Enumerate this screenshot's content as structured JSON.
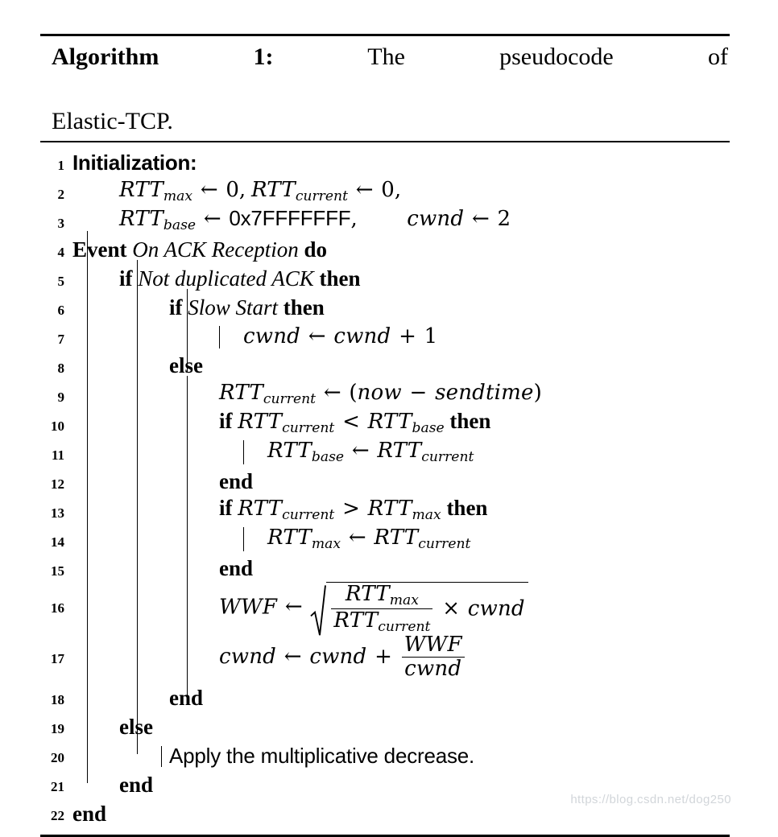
{
  "caption": {
    "label": "Algorithm 1:",
    "text_rest": "The pseudocode of",
    "line2": "Elastic-TCP."
  },
  "keywords": {
    "event": "Event",
    "do": "do",
    "if": "if",
    "then": "then",
    "else": "else",
    "end": "end"
  },
  "symbols": {
    "assign": "←",
    "lt": "<",
    "gt": ">",
    "plus": "+",
    "minus": "−",
    "times": "×",
    "comma": ",",
    "lparen": "(",
    "rparen": ")"
  },
  "vars": {
    "RTT": "RTT",
    "sub_max": "max",
    "sub_current": "current",
    "sub_base": "base",
    "cwnd": "cwnd",
    "WWF": "WWF",
    "now": "now",
    "sendtime": "sendtime"
  },
  "values": {
    "zero": "0",
    "one": "1",
    "two": "2",
    "hex_max": "0x7FFFFFFF"
  },
  "lines": [
    {
      "no": "1",
      "text": "Initialization:"
    },
    {
      "no": "2",
      "text": "RTTmax ← 0, RTTcurrent ← 0,"
    },
    {
      "no": "3",
      "text": "RTTbase ← 0x7FFFFFFF,     cwnd ← 2"
    },
    {
      "no": "4",
      "text": "Event On ACK Reception do"
    },
    {
      "no": "5",
      "text": "if Not duplicated ACK then"
    },
    {
      "no": "6",
      "text": "if Slow Start then"
    },
    {
      "no": "7",
      "text": "cwnd ← cwnd + 1"
    },
    {
      "no": "8",
      "text": "else"
    },
    {
      "no": "9",
      "text": "RTTcurrent ← (now − sendtime)"
    },
    {
      "no": "10",
      "text": "if RTTcurrent < RTTbase then"
    },
    {
      "no": "11",
      "text": "RTTbase ← RTTcurrent"
    },
    {
      "no": "12",
      "text": "end"
    },
    {
      "no": "13",
      "text": "if RTTcurrent > RTTmax then"
    },
    {
      "no": "14",
      "text": "RTTmax ← RTTcurrent"
    },
    {
      "no": "15",
      "text": "end"
    },
    {
      "no": "16",
      "text": "WWF ← sqrt( RTTmax / RTTcurrent × cwnd )"
    },
    {
      "no": "17",
      "text": "cwnd ← cwnd + WWF / cwnd"
    },
    {
      "no": "18",
      "text": "end"
    },
    {
      "no": "19",
      "text": "else"
    },
    {
      "no": "20",
      "text": "Apply the multiplicative decrease."
    },
    {
      "no": "21",
      "text": "end"
    },
    {
      "no": "22",
      "text": "end"
    }
  ],
  "events": {
    "on_ack_reception": "On ACK Reception",
    "not_duplicated_ack": "Not duplicated ACK",
    "slow_start": "Slow Start",
    "multiplicative_decrease": "Apply the multiplicative decrease."
  },
  "watermark": "https://blog.csdn.net/dog250"
}
